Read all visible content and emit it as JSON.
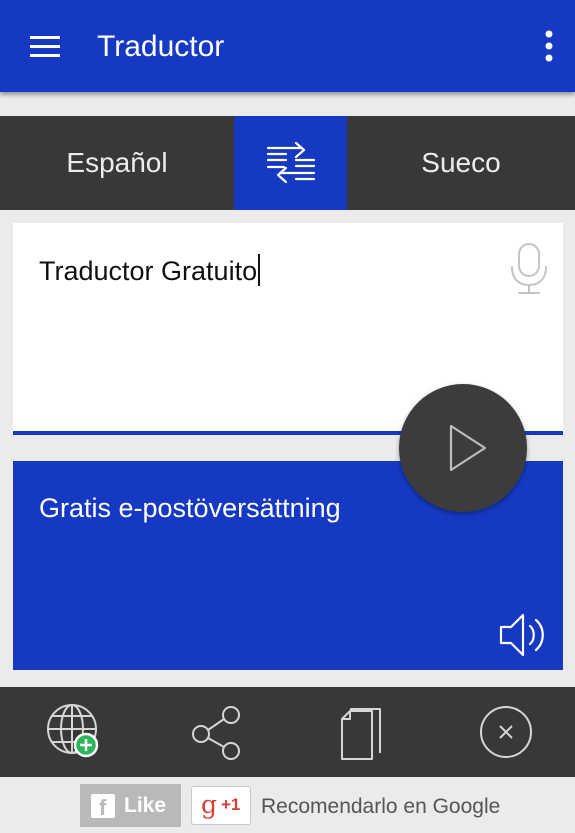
{
  "app_bar": {
    "title": "Traductor",
    "menu_icon": "hamburger-menu-icon",
    "overflow_icon": "more-vert-icon"
  },
  "language_bar": {
    "source_language": "Español",
    "target_language": "Sueco",
    "swap_icon": "swap-arrows-icon"
  },
  "input": {
    "text": "Traductor Gratuito",
    "mic_icon": "microphone-icon"
  },
  "translate_button": {
    "icon": "play-icon"
  },
  "output": {
    "text": "Gratis e-postöversättning",
    "speaker_icon": "speaker-icon"
  },
  "toolbar": {
    "icons": [
      "globe-add-icon",
      "share-icon",
      "copy-icon",
      "clear-icon"
    ]
  },
  "footer": {
    "like_label": "Like",
    "gplus_label": "+1",
    "recommend_text": "Recomendarlo en Google"
  },
  "colors": {
    "primary": "#1539c2",
    "dark_bar": "#383838",
    "play_button": "#3c3c3c",
    "background": "#ebebeb",
    "accent_green": "#2db55d"
  }
}
